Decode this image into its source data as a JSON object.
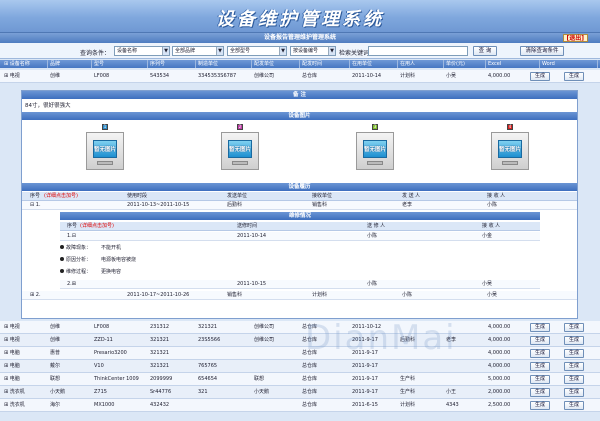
{
  "app": {
    "title": "设备维护管理系统",
    "subtitle": "设备报告管理维护管理系统",
    "logout": "[退出]"
  },
  "search": {
    "label": "查询条件：",
    "filters": [
      "设备名称",
      "全部品牌",
      "全部型号",
      "按设备编号"
    ],
    "keyword_label": "检索关键词：",
    "query_button": "查 询",
    "clear_button": "清除查询条件"
  },
  "columns": [
    "设备名称",
    "品牌",
    "型号",
    "序列号",
    "制造单位",
    "配发单位",
    "配发时间",
    "在用单位",
    "在用人",
    "单价(元)",
    "Excel",
    "Word"
  ],
  "export_label": "生成",
  "rows_top": [
    [
      "电视",
      "创维",
      "LF008",
      "543534",
      "3345353S6787",
      "创维公司",
      "总仓库",
      "2011-10-14",
      "计划科",
      "小吴",
      "4,000.00"
    ]
  ],
  "detail": {
    "remark_title": "备 注",
    "remark_text": "84寸，很好很强大",
    "photos_title": "设备图片",
    "photos": [
      {
        "num": "1",
        "label": "暂无图片",
        "color": "#2f8cc8"
      },
      {
        "num": "2",
        "label": "暂无图片",
        "color": "#c23fa8"
      },
      {
        "num": "3",
        "label": "暂无图片",
        "color": "#7fbf2f"
      },
      {
        "num": "4",
        "label": "暂无图片",
        "color": "#d42020"
      }
    ],
    "history_title": "设备履历",
    "history_head": [
      "序号",
      "(详细点击加号)",
      "使用时段",
      "发送单位",
      "接收单位",
      "发 送 人",
      "接 收 人"
    ],
    "history_rows": [
      [
        "1.",
        "2011-10-13~2011-10-15",
        "后勤科",
        "销售科",
        "老李",
        "小陈"
      ],
      [
        "2.",
        "2011-10-17~2011-10-26",
        "销售科",
        "计划科",
        "小陈",
        "小吴"
      ]
    ],
    "repair_title": "维修情况",
    "repair_head": [
      "序号",
      "(详细点击加号)",
      "送修时间",
      "送 修 人",
      "接 收 人"
    ],
    "repair_rows": [
      [
        "1.",
        "2011-10-14",
        "小陈",
        "小金"
      ],
      [
        "2.",
        "2011-10-15",
        "小陈",
        "小吴"
      ]
    ],
    "fault": [
      {
        "label": "故障现象：",
        "value": "不能开机"
      },
      {
        "label": "原因分析：",
        "value": "电源板电容被烧"
      },
      {
        "label": "维修过程：",
        "value": "更换电容"
      }
    ]
  },
  "rows_bottom": [
    [
      "电视",
      "创维",
      "LF008",
      "231312",
      "321321",
      "创维公司",
      "总仓库",
      "2011-10-12",
      "",
      "",
      "4,000.00"
    ],
    [
      "电视",
      "创维",
      "ZZD-11",
      "321321",
      "23S5566",
      "创维公司",
      "总仓库",
      "2011-9-17",
      "后勤科",
      "老李",
      "4,000.00"
    ],
    [
      "电脑",
      "惠普",
      "Presario3200",
      "321321",
      "",
      "",
      "总仓库",
      "2011-9-17",
      "",
      "",
      "4,000.00"
    ],
    [
      "电脑",
      "戴尔",
      "V10",
      "321321",
      "765765",
      "",
      "总仓库",
      "2011-9-17",
      "",
      "",
      "4,000.00"
    ],
    [
      "电脑",
      "联想",
      "ThinkCenter 1009",
      "2099999",
      "654654",
      "联想",
      "总仓库",
      "2011-9-17",
      "生产科",
      "",
      "5,000.00"
    ],
    [
      "洗衣机",
      "小天鹅",
      "Z715",
      "Sr44776",
      "321",
      "小天鹅",
      "总仓库",
      "2011-9-17",
      "生产科",
      "小王",
      "2,000.00"
    ],
    [
      "洗衣机",
      "海尔",
      "MX1000",
      "432432",
      "",
      "",
      "总仓库",
      "2011-6-15",
      "计划科",
      "4343",
      "2,500.00"
    ]
  ],
  "watermark": "DianMai"
}
